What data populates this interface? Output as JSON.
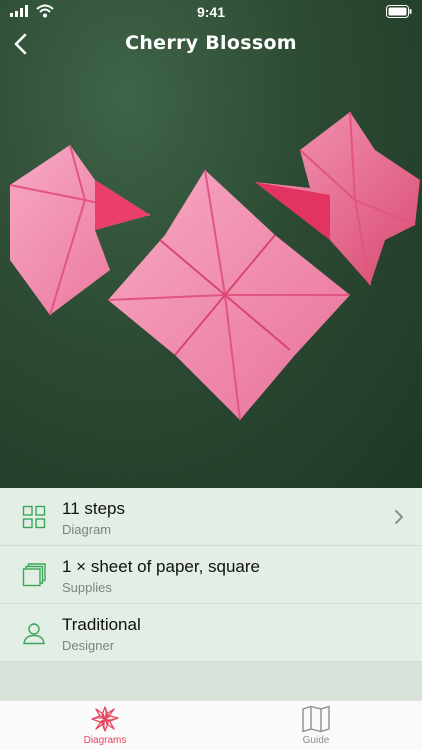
{
  "status_bar": {
    "time": "9:41"
  },
  "nav": {
    "title": "Cherry Blossom"
  },
  "info_rows": [
    {
      "icon": "grid-icon",
      "primary": "11 steps",
      "secondary": "Diagram",
      "has_chevron": true
    },
    {
      "icon": "paper-stack-icon",
      "primary": "1 × sheet of paper, square",
      "secondary": "Supplies",
      "has_chevron": false
    },
    {
      "icon": "person-icon",
      "primary": "Traditional",
      "secondary": "Designer",
      "has_chevron": false
    }
  ],
  "tab_bar": {
    "tabs": [
      {
        "label": "Diagrams",
        "icon": "blossom-icon",
        "selected": true
      },
      {
        "label": "Guide",
        "icon": "map-icon",
        "selected": false
      }
    ]
  },
  "colors": {
    "accent": "#e5455f",
    "icon_green": "#3aa65b",
    "list_background": "#e3eee4",
    "photo_background": "#2c4a33"
  }
}
